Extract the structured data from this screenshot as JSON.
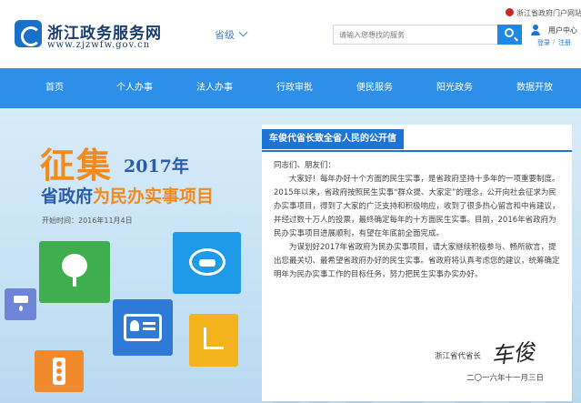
{
  "header": {
    "site_title": "浙江政务服务网",
    "site_url": "www.zjzwfw.gov.cn",
    "region_label": "省级",
    "search_placeholder": "请输入您想找的服务",
    "gov_portal_label": "浙江省政府门户网站",
    "user_center_label": "用户中心",
    "login_label": "登录",
    "separator": "/",
    "register_label": "注册"
  },
  "nav": {
    "items": [
      {
        "label": "首页"
      },
      {
        "label": "个人办事"
      },
      {
        "label": "法人办事"
      },
      {
        "label": "行政审批"
      },
      {
        "label": "便民服务"
      },
      {
        "label": "阳光政务"
      },
      {
        "label": "数据开放"
      }
    ]
  },
  "banner": {
    "collect_word": "征集",
    "year": "2017年",
    "subtitle_prefix": "省政府",
    "subtitle_highlight": "为民办实事项目",
    "start_date": "开始时间：2016年11月4日"
  },
  "letter": {
    "title": "车俊代省长致全省人民的公开信",
    "greeting": "同志们、朋友们：",
    "paragraph1": "大家好！每年办好十个方面的民生实事，是省政府坚持十多年的一项重要制度。2015年以来，省政府按照民生实事“群众提、大家定”的理念，公开向社会征求为民办实事项目，得到了大家的广泛支持和积极响应，收到了很多热心留言和中肯建议，并经过数十万人的投票，最终确定每年的十方面民生实事。目前，2016年省政府为民办实事项目进展顺利，有望在年底前全面完成。",
    "paragraph2": "为谋划好2017年省政府为民办实事项目，请大家继续积极参与、畅所欲言，提出您最关切、最希望省政府办好的民生实事。省政府将认真考虑您的建议，统筹确定明年为民办实事工作的目标任务，努力把民生实事办实办好。",
    "sign_label": "浙江省代省长",
    "date": "二〇一六年十一月三日"
  }
}
